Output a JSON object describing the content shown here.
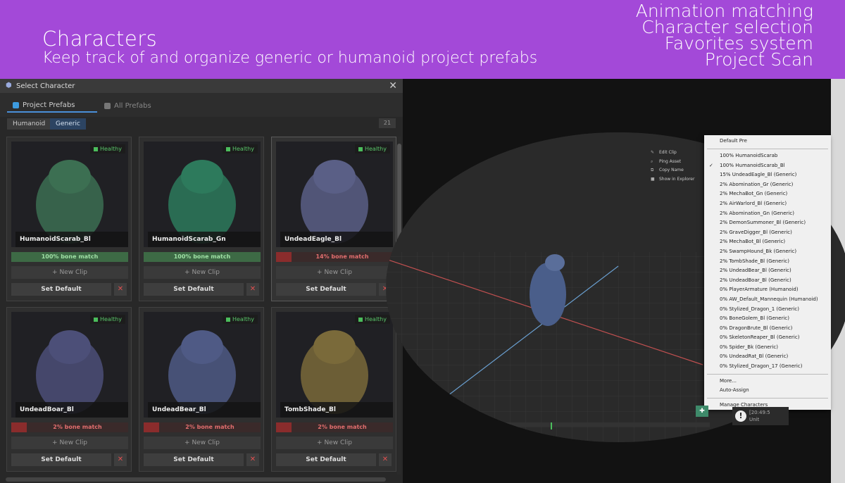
{
  "banner": {
    "title": "Characters",
    "subtitle": "Keep track of and organize generic or humanoid project prefabs",
    "features": [
      "Animation matching",
      "Character selection",
      "Favorites system",
      "Project Scan"
    ]
  },
  "window": {
    "title": "Select Character",
    "tabs": [
      {
        "label": "Project Prefabs",
        "active": true
      },
      {
        "label": "All Prefabs",
        "active": false
      }
    ],
    "filters": [
      {
        "label": "Humanoid",
        "active": false
      },
      {
        "label": "Generic",
        "active": true
      }
    ],
    "count": "21",
    "status_label": "Healthy",
    "new_clip_label": "+ New Clip",
    "set_default_label": "Set Default",
    "remove_glyph": "✕",
    "cards": [
      {
        "name": "HumanoidScarab_Bl",
        "match": "100% bone match",
        "match_fraction": 1.0,
        "color": "#3c6f52"
      },
      {
        "name": "HumanoidScarab_Gn",
        "match": "100% bone match",
        "match_fraction": 1.0,
        "color": "#2d7a5c"
      },
      {
        "name": "UndeadEagle_Bl",
        "match": "14% bone match",
        "match_fraction": 0.14,
        "color": "#5a5f86"
      },
      {
        "name": "UndeadBoar_Bl",
        "match": "2% bone match",
        "match_fraction": 0.02,
        "color": "#4c4f78"
      },
      {
        "name": "UndeadBear_Bl",
        "match": "2% bone match",
        "match_fraction": 0.02,
        "color": "#4f5a85"
      },
      {
        "name": "TombShade_Bl",
        "match": "2% bone match",
        "match_fraction": 0.02,
        "color": "#7a6a3a"
      }
    ]
  },
  "context_menu": [
    "Edit Clip",
    "Ping Asset",
    "Copy Name",
    "Show in Explorer"
  ],
  "dropdown": {
    "header": "Default Pre",
    "items": [
      {
        "label": "100%  HumanoidScarab",
        "checked": false
      },
      {
        "label": "100%  HumanoidScarab_Bl",
        "checked": true
      },
      {
        "label": "15%  UndeadEagle_Bl   (Generic)",
        "checked": false
      },
      {
        "label": "2%  Abomination_Gr   (Generic)",
        "checked": false
      },
      {
        "label": "2%  MechaBot_Gn   (Generic)",
        "checked": false
      },
      {
        "label": "2%  AirWarlord_Bl   (Generic)",
        "checked": false
      },
      {
        "label": "2%  Abomination_Gn   (Generic)",
        "checked": false
      },
      {
        "label": "2%  DemonSummoner_Bl   (Generic)",
        "checked": false
      },
      {
        "label": "2%  GraveDigger_Bl   (Generic)",
        "checked": false
      },
      {
        "label": "2%  MechaBot_Bl   (Generic)",
        "checked": false
      },
      {
        "label": "2%  SwampHound_Bk   (Generic)",
        "checked": false
      },
      {
        "label": "2%  TombShade_Bl   (Generic)",
        "checked": false
      },
      {
        "label": "2%  UndeadBear_Bl   (Generic)",
        "checked": false
      },
      {
        "label": "2%  UndeadBoar_Bl   (Generic)",
        "checked": false
      },
      {
        "label": "0%  PlayerArmature   (Humanoid)",
        "checked": false
      },
      {
        "label": "0%  AW_Default_Mannequin   (Humanoid)",
        "checked": false
      },
      {
        "label": "0%  Stylized_Dragon_1   (Generic)",
        "checked": false
      },
      {
        "label": "0%  BoneGolem_Bl   (Generic)",
        "checked": false
      },
      {
        "label": "0%  DragonBrute_Bl   (Generic)",
        "checked": false
      },
      {
        "label": "0%  SkeletonReaper_Bl   (Generic)",
        "checked": false
      },
      {
        "label": "0%  Spider_Bk   (Generic)",
        "checked": false
      },
      {
        "label": "0%  UndeadRat_Bl   (Generic)",
        "checked": false
      },
      {
        "label": "0%  Stylized_Dragon_17   (Generic)",
        "checked": false
      }
    ],
    "footer": [
      "More...",
      "Auto-Assign",
      "Manage Characters"
    ]
  },
  "notice": {
    "time": "[20:49:5",
    "text": "Unit"
  }
}
